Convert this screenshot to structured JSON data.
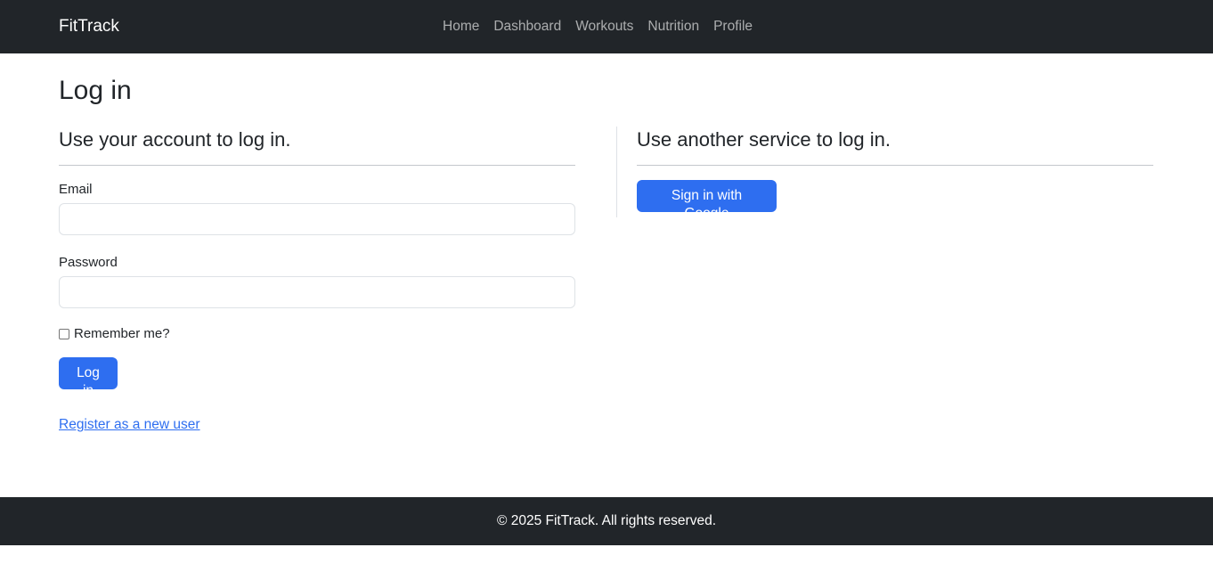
{
  "navbar": {
    "brand": "FitTrack",
    "links": [
      "Home",
      "Dashboard",
      "Workouts",
      "Nutrition",
      "Profile"
    ]
  },
  "page": {
    "title": "Log in"
  },
  "local_login": {
    "heading": "Use your account to log in.",
    "email_label": "Email",
    "email_value": "",
    "password_label": "Password",
    "password_value": "",
    "remember_label": "Remember me?",
    "remember_checked": false,
    "submit_label": "Log in",
    "register_link": "Register as a new user"
  },
  "external_login": {
    "heading": "Use another service to log in.",
    "google_button": "Sign in with Google"
  },
  "footer": {
    "text": "© 2025 FitTrack. All rights reserved."
  },
  "colors": {
    "navbar_bg": "#212529",
    "primary": "#2e6ef0",
    "text": "#212529",
    "border": "#dee2e6"
  }
}
